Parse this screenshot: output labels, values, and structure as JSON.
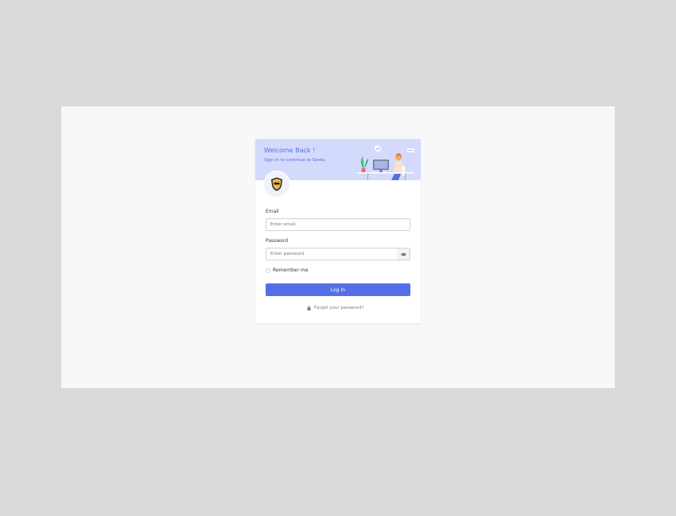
{
  "banner": {
    "title": "Welcome Back !",
    "subtitle": "Sign in to continue to Skote."
  },
  "form": {
    "email_label": "Email",
    "email_placeholder": "Enter email",
    "email_value": "",
    "password_label": "Password",
    "password_placeholder": "Enter password",
    "password_value": "",
    "remember_label": "Remember me",
    "remember_checked": false,
    "login_label": "Log In",
    "forgot_label": "Forgot your password?"
  },
  "icons": {
    "logo": "logo-icon",
    "eye": "eye-icon",
    "lock": "lock-icon"
  },
  "colors": {
    "primary": "#556ee6",
    "banner_bg": "#d4dafc",
    "page_bg": "#f8f8fb"
  }
}
